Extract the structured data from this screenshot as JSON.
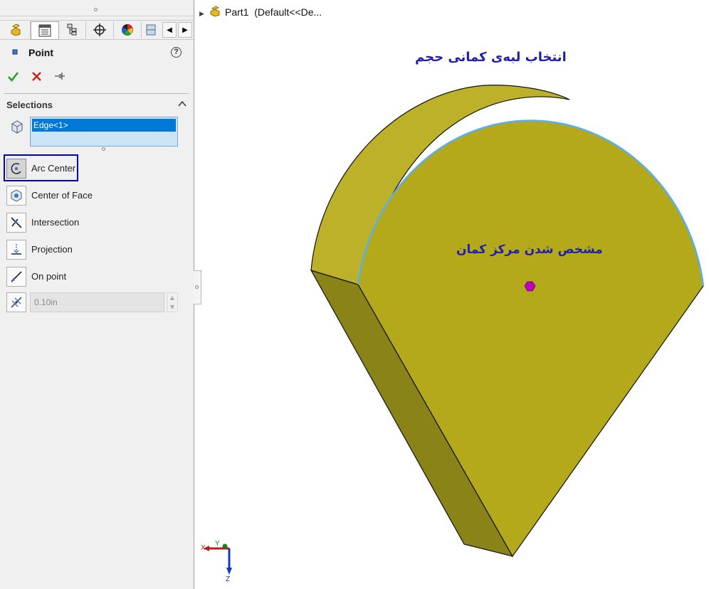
{
  "tabs": [
    {
      "icon": "part-feature-manager-icon"
    },
    {
      "icon": "property-manager-icon"
    },
    {
      "icon": "configuration-manager-icon"
    },
    {
      "icon": "dimxpert-manager-icon"
    },
    {
      "icon": "display-manager-icon"
    },
    {
      "icon": "cam-manager-icon"
    }
  ],
  "property_manager": {
    "title": "Point",
    "help_label": "?",
    "selections_title": "Selections",
    "selected_items": [
      "Edge<1>"
    ],
    "options": [
      {
        "label": "Arc Center",
        "icon": "arc-center-icon",
        "selected": true
      },
      {
        "label": "Center of Face",
        "icon": "center-of-face-icon"
      },
      {
        "label": "Intersection",
        "icon": "intersection-icon"
      },
      {
        "label": "Projection",
        "icon": "projection-icon"
      },
      {
        "label": "On point",
        "icon": "on-point-icon"
      }
    ],
    "distance_value": "0.10in"
  },
  "tree": {
    "part_name": "Part1",
    "config": "(Default<<De..."
  },
  "annotations": {
    "top": "انتخاب لبه‌ی کمانی حجم",
    "center": "مشخص شدن مرکز کمان"
  },
  "triad": {
    "x": "X",
    "y": "Y",
    "z": "Z"
  },
  "colors": {
    "model_face": "#b3a91a",
    "model_side_top": "#c0b52a",
    "model_side_left": "#8a8318",
    "selected_edge": "#5aaef0",
    "center_point": "#c000c0",
    "annotation": "#2020b0",
    "highlight_box": "#0000c8",
    "selection_bg": "#0078d7"
  }
}
